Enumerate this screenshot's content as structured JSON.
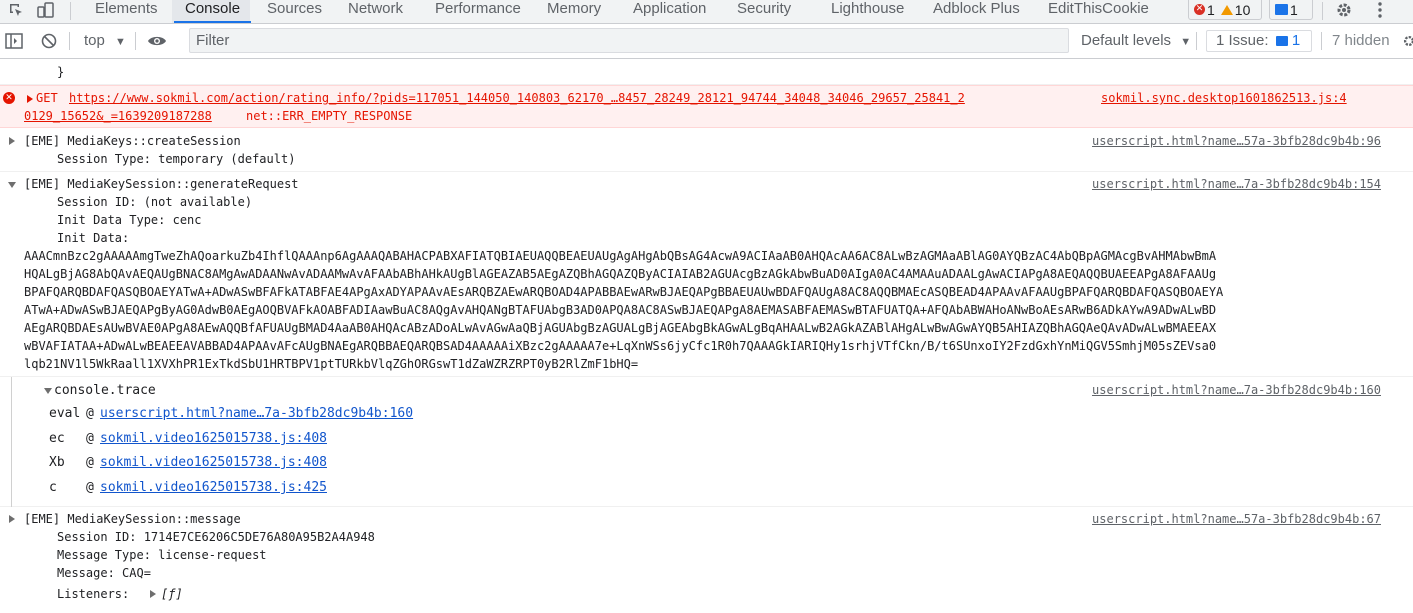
{
  "tabs": [
    {
      "label": "Elements"
    },
    {
      "label": "Console"
    },
    {
      "label": "Sources"
    },
    {
      "label": "Network"
    },
    {
      "label": "Performance"
    },
    {
      "label": "Memory"
    },
    {
      "label": "Application"
    },
    {
      "label": "Security"
    },
    {
      "label": "Lighthouse"
    },
    {
      "label": "Adblock Plus"
    },
    {
      "label": "EditThisCookie"
    }
  ],
  "counters": {
    "errors": "1",
    "warnings": "10",
    "messages": "1"
  },
  "toolbar": {
    "context": "top",
    "filter_placeholder": "Filter",
    "levels": "Default levels",
    "issues_label": "1 Issue:",
    "issues_count": "1",
    "hidden": "7 hidden"
  },
  "console": {
    "partial_close": "}",
    "error": {
      "method": "GET",
      "url": "https://www.sokmil.com/action/rating_info/?pids=117051_144050_140803_62170_…8457_28249_28121_94744_34048_34046_29657_25841_2",
      "url_cont": "0129_15652&_=1639209187288",
      "status": "net::ERR_EMPTY_RESPONSE",
      "source": "sokmil.sync.desktop1601862513.js:4"
    },
    "m1": {
      "title": "[EME] MediaKeys::createSession",
      "line1": "Session Type: temporary (default)",
      "source": "userscript.html?name…57a-3bfb28dc9b4b:96"
    },
    "m2": {
      "title": "[EME] MediaKeySession::generateRequest",
      "line1": "Session ID: (not available)",
      "line2": "Init Data Type: cenc",
      "line3": "Init Data:",
      "source": "userscript.html?name…7a-3bfb28dc9b4b:154",
      "data": [
        "AAACmnBzc2gAAAAAmgTweZhAQoarkuZb4IhflQAAAnp6AgAAAQABAHACPABXAFIATQBIAEUAQQBEAEUAUgAgAHgAbQBsAG4AcwA9ACIAaAB0AHQAcAA6AC8ALwBzAGMAaABlAG0AYQBzAC4AbQBpAGMAcgBvAHMAbwBmA",
        "HQALgBjAG8AbQAvAEQAUgBNAC8AMgAwADAANwAvADAAMwAvAFAAbABhAHkAUgBlAGEAZAB5AEgAZQBhAGQAZQByACIAIAB2AGUAcgBzAGkAbwBuAD0AIgA0AC4AMAAuADAALgAwACIAPgA8AEQAQQBUAEEAPgA8AFAAUg",
        "BPAFQARQBDAFQASQBOAEYATwA+ADwASwBFAFkATABFAE4APgAxADYAPAAvAEsARQBZAEwARQBOAD4APABBAEwARwBJAEQAPgBBAEUAUwBDAFQAUgA8AC8AQQBMAEcASQBEAD4APAAvAFAAUgBPAFQARQBDAFQASQBOAEYA",
        "ATwA+ADwASwBJAEQAPgByAG0AdwB0AEgAOQBVAFkAOABFADIAawBuAC8AQgAvAHQANgBTAFUAbgB3AD0APQA8AC8ASwBJAEQAPgA8AEMASABFAEMASwBTAFUATQA+AFQAbABWAHoANwBoAEsARwB6ADkAYwA9ADwALwBD",
        "AEgARQBDAEsAUwBVAE0APgA8AEwAQQBfAFUAUgBMAD4AaAB0AHQAcABzADoALwAvAGwAaQBjAGUAbgBzAGUALgBjAGEAbgBkAGwALgBqAHAALwB2AGkAZABlAHgALwBwAGwAYQB5AHIAZQBhAGQAeQAvADwALwBMAEEAX",
        "wBVAFIATAA+ADwALwBEAEEAVABBAD4APAAvAFcAUgBNAEgARQBBAEQARQBSAD4AAAAAiXBzc2gAAAAA7e+LqXnWSs6jyCfc1R0h7QAAAGkIARIQHy1srhjVTfCkn/B/t6SUnxoIY2FzdGxhYnMiQGV5SmhjM05sZEVsa0",
        "lqb21NV1l5WkRaall1XVXhPR1ExTkdSbU1HRTBPV1ptTURkbVlqZGhORGswT1dZaWZRZRPT0yB2RlZmF1bHQ="
      ]
    },
    "trace": {
      "title": "console.trace",
      "source": "userscript.html?name…7a-3bfb28dc9b4b:160",
      "frames": [
        {
          "fn": "eval",
          "at": "@",
          "loc": "userscript.html?name…7a-3bfb28dc9b4b:160"
        },
        {
          "fn": "ec",
          "at": "@",
          "loc": "sokmil.video1625015738.js:408"
        },
        {
          "fn": "Xb",
          "at": "@",
          "loc": "sokmil.video1625015738.js:408"
        },
        {
          "fn": "c",
          "at": "@",
          "loc": "sokmil.video1625015738.js:425"
        }
      ]
    },
    "m3": {
      "title": "[EME] MediaKeySession::message",
      "line1": "Session ID: 1714E7CE6206C5DE76A80A95B2A4A948",
      "line2": "Message Type: license-request",
      "line3": "Message: CAQ=",
      "line4": "Listeners:",
      "line4_val": "[ƒ]",
      "source": "userscript.html?name…57a-3bfb28dc9b4b:67"
    }
  }
}
